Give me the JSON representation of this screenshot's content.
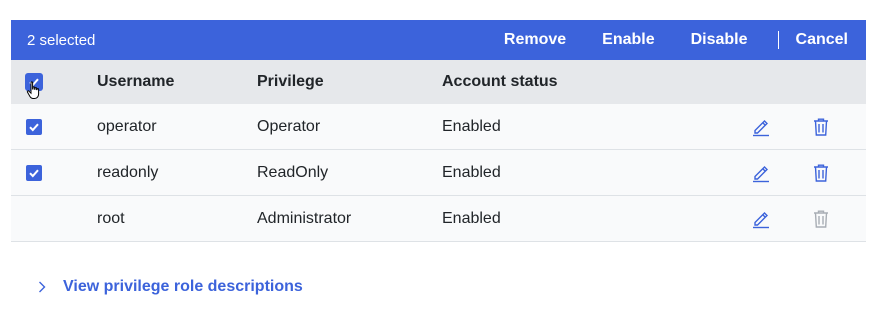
{
  "toolbar": {
    "selected_text": "2 selected",
    "actions": [
      "Remove",
      "Enable",
      "Disable"
    ],
    "cancel": "Cancel"
  },
  "table": {
    "columns": [
      "Username",
      "Privilege",
      "Account status"
    ],
    "rows": [
      {
        "username": "operator",
        "privilege": "Operator",
        "status": "Enabled",
        "selected": true
      },
      {
        "username": "readonly",
        "privilege": "ReadOnly",
        "status": "Enabled",
        "selected": true
      },
      {
        "username": "root",
        "privilege": "Administrator",
        "status": "Enabled",
        "selected": false
      }
    ]
  },
  "footer": {
    "link_label": "View privilege role descriptions"
  },
  "colors": {
    "primary": "#3c63db",
    "header_bg": "#e6e8eb",
    "row_bg": "#f9fafb",
    "disabled_icon": "#a8adb4"
  },
  "icons": [
    "check-icon",
    "pencil-icon",
    "trash-icon",
    "chevron-right-icon",
    "hand-cursor-icon"
  ]
}
